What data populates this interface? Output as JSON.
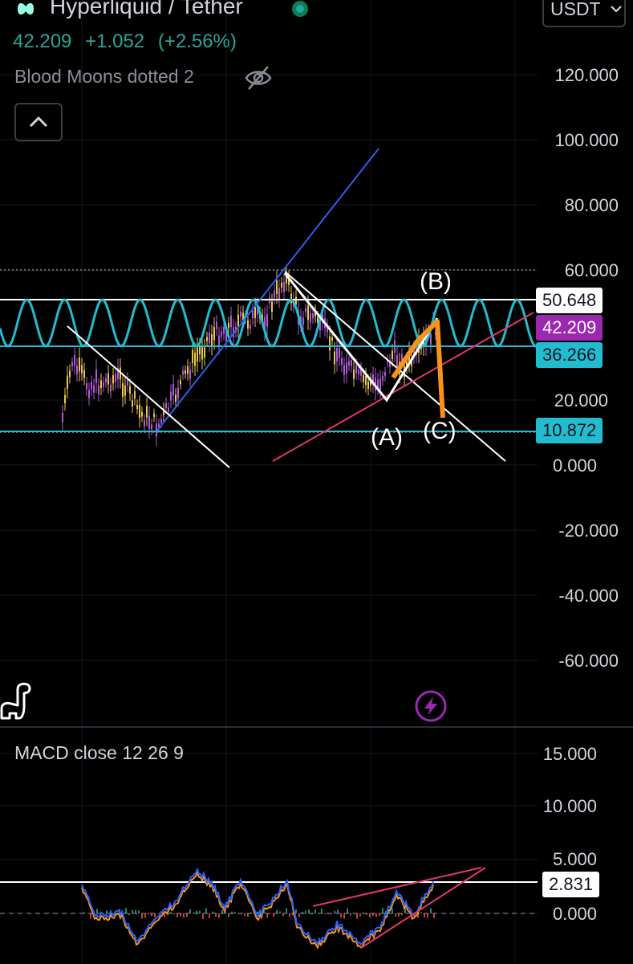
{
  "header": {
    "title": "Hyperliquid / Tether",
    "currency": "USDT",
    "price": "42.209",
    "change": "+1.052",
    "change_pct": "(+2.56%)"
  },
  "indicator": {
    "name": "Blood Moons dotted 2"
  },
  "price_axis": {
    "labels": [
      "120.000",
      "100.000",
      "80.000",
      "60.000",
      "20.000",
      "0.000",
      "-20.000",
      "-40.000",
      "-60.000"
    ]
  },
  "price_tags": {
    "upper_line": "50.648",
    "current": "42.209",
    "wave_mid": "36.266",
    "lower_line": "10.872"
  },
  "wave_labels": {
    "a": "(A)",
    "b": "(B)",
    "c": "(C)"
  },
  "macd": {
    "title": "MACD close 12 26 9",
    "axis_labels": [
      "15.000",
      "10.000",
      "5.000",
      "0.000"
    ],
    "tag": "2.831"
  },
  "colors": {
    "up": "#26a69a",
    "cyan": "#22bcd0",
    "purple": "#9c27b0",
    "blue_line": "#2f5fe8",
    "pink_line": "#e0386a",
    "orange": "#f7931a"
  },
  "icons": {
    "eye": "eye-crossed-icon",
    "collapse": "chevron-up-icon",
    "currency": "chevron-down-icon",
    "logo": "hyperliquid-logo-icon",
    "dino": "dinosaur-icon",
    "bolt": "lightning-bolt-icon"
  }
}
